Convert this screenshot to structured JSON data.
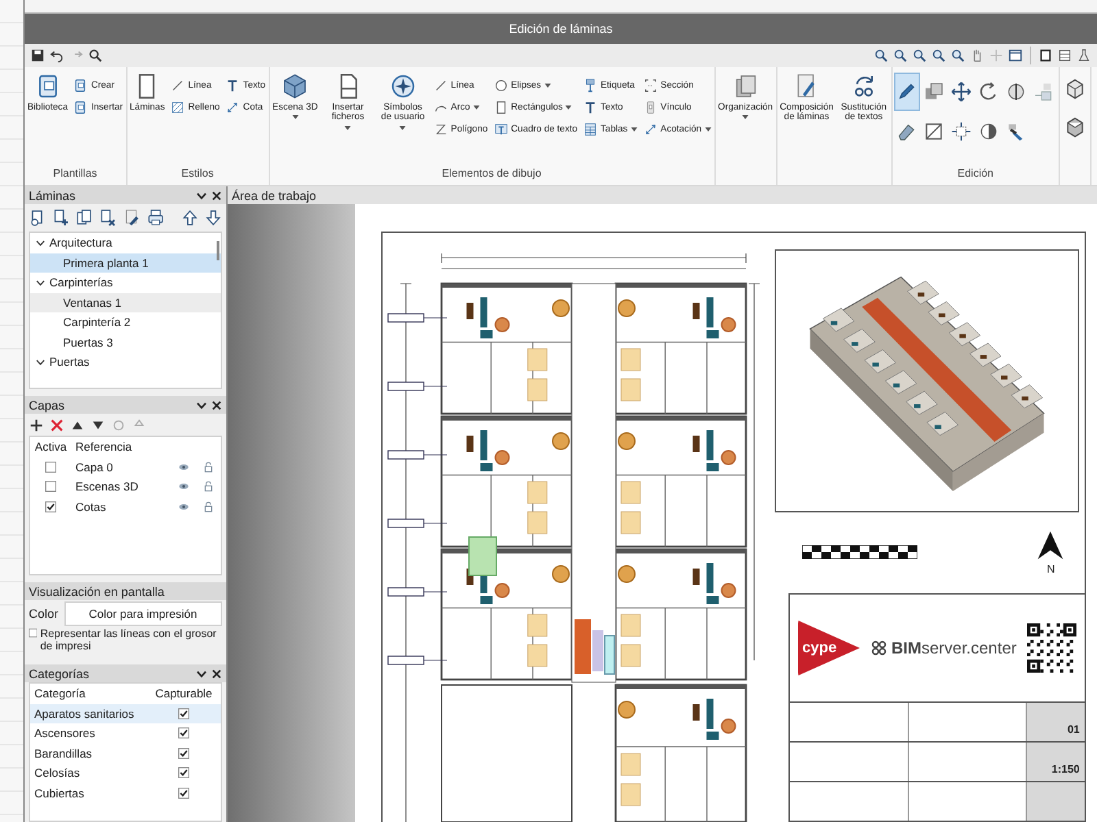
{
  "window": {
    "title": "Edición de láminas"
  },
  "ribbon": {
    "groups": [
      {
        "kind": "tools",
        "label": "Plantillas",
        "columns": [
          [
            {
              "label": "Biblioteca",
              "kind": "large",
              "dropdown": false
            }
          ],
          [
            {
              "label": "Crear",
              "kind": "small",
              "dropdown": false
            },
            {
              "label": "Insertar",
              "kind": "small",
              "dropdown": false
            }
          ]
        ]
      },
      {
        "kind": "tools",
        "label": "Estilos",
        "columns": [
          [
            {
              "label": "Láminas",
              "kind": "large",
              "dropdown": false
            }
          ],
          [
            {
              "label": "Línea",
              "kind": "small",
              "dropdown": false
            },
            {
              "label": "Relleno",
              "kind": "small",
              "dropdown": false
            }
          ],
          [
            {
              "label": "Texto",
              "kind": "small",
              "dropdown": false
            },
            {
              "label": "Cota",
              "kind": "small",
              "dropdown": false
            }
          ]
        ]
      },
      {
        "kind": "tools",
        "label": "Elementos de dibujo",
        "columns": [
          [
            {
              "label": "Escena 3D",
              "kind": "large",
              "dropdown": true
            }
          ],
          [
            {
              "label": "Insertar ficheros",
              "kind": "large",
              "dropdown": true
            }
          ],
          [
            {
              "label": "Símbolos de usuario",
              "kind": "large",
              "dropdown": true
            }
          ],
          [
            {
              "label": "Línea",
              "kind": "small",
              "dropdown": false
            },
            {
              "label": "Arco",
              "kind": "small",
              "dropdown": true
            },
            {
              "label": "Polígono",
              "kind": "small",
              "dropdown": false
            }
          ],
          [
            {
              "label": "Elipses",
              "kind": "small",
              "dropdown": true
            },
            {
              "label": "Rectángulos",
              "kind": "small",
              "dropdown": true
            },
            {
              "label": "Cuadro de texto",
              "kind": "small",
              "dropdown": false
            }
          ],
          [
            {
              "label": "Etiqueta",
              "kind": "small",
              "dropdown": false
            },
            {
              "label": "Texto",
              "kind": "small",
              "dropdown": false
            },
            {
              "label": "Tablas",
              "kind": "small",
              "dropdown": true
            }
          ],
          [
            {
              "label": "Sección",
              "kind": "small",
              "dropdown": false
            },
            {
              "label": "Vínculo",
              "kind": "small",
              "dropdown": false
            },
            {
              "label": "Acotación",
              "kind": "small",
              "dropdown": true
            }
          ]
        ]
      },
      {
        "kind": "tools",
        "columns": [
          [
            {
              "label": "Organización",
              "kind": "large",
              "dropdown": true
            }
          ]
        ]
      },
      {
        "kind": "tools",
        "columns": [
          [
            {
              "label": "Composición de láminas",
              "kind": "large",
              "dropdown": false
            }
          ],
          [
            {
              "label": "Sustitución de textos",
              "kind": "large",
              "dropdown": false
            }
          ]
        ]
      },
      {
        "kind": "icons",
        "label": "Edición",
        "tools": [
          {
            "selected": true
          },
          {
            "selected": false
          },
          {
            "selected": false
          },
          {
            "selected": false
          },
          {
            "selected": false
          },
          {
            "selected": false
          },
          {
            "selected": false
          },
          {
            "selected": false
          },
          {
            "selected": false
          },
          {
            "selected": false
          },
          {
            "selected": false
          }
        ]
      },
      {
        "kind": "icons",
        "tools": [
          {
            "selected": false
          },
          {
            "selected": false
          }
        ]
      }
    ]
  },
  "sheets_panel": {
    "title": "Láminas",
    "tree": [
      {
        "label": "Arquitectura",
        "expanded": true,
        "selected": false,
        "hovered": false,
        "children": [
          {
            "label": "Primera planta 1",
            "selected": true,
            "hovered": false
          }
        ]
      },
      {
        "label": "Carpinterías",
        "expanded": true,
        "selected": false,
        "hovered": false,
        "children": [
          {
            "label": "Ventanas 1",
            "selected": false,
            "hovered": true
          },
          {
            "label": "Carpintería 2",
            "selected": false,
            "hovered": false
          },
          {
            "label": "Puertas 3",
            "selected": false,
            "hovered": false
          }
        ]
      },
      {
        "label": "Puertas",
        "expanded": true,
        "selected": false,
        "hovered": false
      }
    ]
  },
  "layers_panel": {
    "title": "Capas",
    "columns": [
      "Activa",
      "Referencia"
    ],
    "rows": [
      {
        "reference": "Capa 0",
        "active": false
      },
      {
        "reference": "Escenas 3D",
        "active": false
      },
      {
        "reference": "Cotas",
        "active": true
      }
    ]
  },
  "display": {
    "title": "Visualización en pantalla",
    "color_label": "Color",
    "color_value": "Color para impresión",
    "print_weight": {
      "label": "Representar las líneas con el grosor de impresi",
      "checked": false
    }
  },
  "categories_panel": {
    "title": "Categorías",
    "columns": [
      "Categoría",
      "Capturable"
    ],
    "rows": [
      {
        "category": "Aparatos sanitarios",
        "capturable": true,
        "selected": true
      },
      {
        "category": "Ascensores",
        "capturable": true,
        "selected": false
      },
      {
        "category": "Barandillas",
        "capturable": true,
        "selected": false
      },
      {
        "category": "Celosías",
        "capturable": true,
        "selected": false
      },
      {
        "category": "Cubiertas",
        "capturable": true,
        "selected": false
      }
    ]
  },
  "work_area": {
    "title": "Área de trabajo",
    "north_label": "N",
    "title_block": {
      "logo": "cype",
      "brand": "**BIM**server.center",
      "values": [
        "01",
        "1:150"
      ]
    }
  }
}
